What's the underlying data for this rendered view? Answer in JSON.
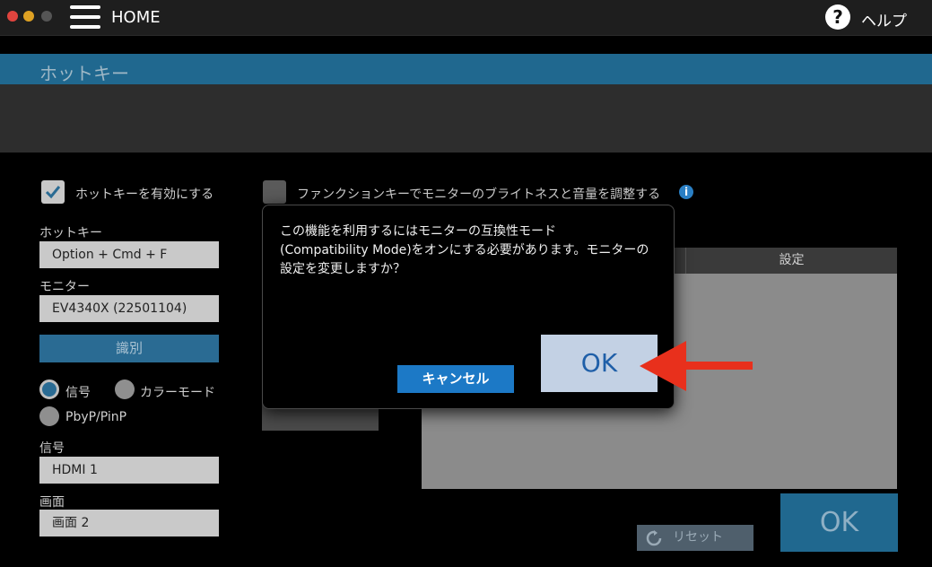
{
  "titlebar": {
    "home_label": "HOME",
    "help_icon_glyph": "?",
    "help_label": "ヘルプ"
  },
  "section": {
    "title": "ホットキー"
  },
  "hotkey": {
    "enable_label": "ホットキーを有効にする",
    "enabled": true,
    "function_key_label": "ファンクションキーでモニターのブライトネスと音量を調整する",
    "function_key_enabled": false,
    "info_icon_glyph": "i",
    "hotkey_label": "ホットキー",
    "hotkey_value": "Option + Cmd + F",
    "monitor_label": "モニター",
    "monitor_value": "EV4340X (22501104)",
    "identify_button": "識別",
    "radio_options": [
      {
        "label": "信号",
        "selected": true
      },
      {
        "label": "カラーモード",
        "selected": false
      },
      {
        "label": "PbyP/PinP",
        "selected": false
      }
    ],
    "signal_label": "信号",
    "signal_value": "HDMI 1",
    "screen_label": "画面",
    "screen_value": "画面 2"
  },
  "table": {
    "settings_header": "設定"
  },
  "footer": {
    "reset_button": "リセット",
    "ok_button": "OK"
  },
  "dialog": {
    "message_lines": [
      "この機能を利用するにはモニターの互換性モード",
      "(Compatibility Mode)をオンにする必要があります。モニターの",
      "設定を変更しますか？"
    ],
    "cancel_button": "キャンセル",
    "ok_button": "OK"
  },
  "colors": {
    "accent": "#20688f",
    "dialog_primary": "#1c79c6",
    "ok_highlight": "#c3d1e4",
    "arrow": "#e8301c"
  },
  "icons": {
    "hamburger": "hamburger-menu-icon",
    "help": "help-circle-icon",
    "info": "info-icon",
    "checkmark": "checkmark-icon",
    "reset": "refresh-icon",
    "arrow": "arrow-left-icon"
  }
}
